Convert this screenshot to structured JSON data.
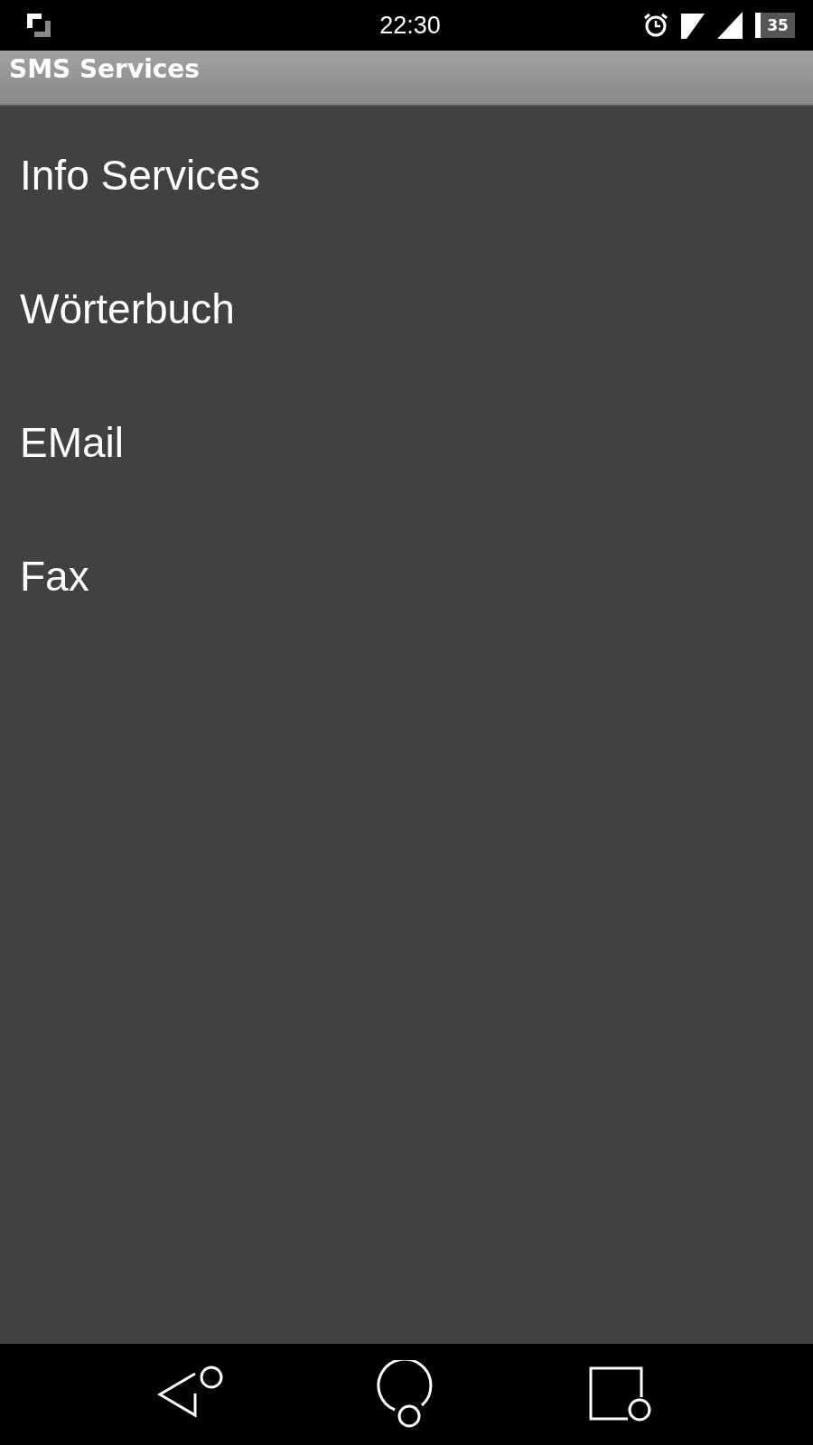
{
  "status_bar": {
    "time": "22:30",
    "battery": "35"
  },
  "app_bar": {
    "title": "SMS Services"
  },
  "items": [
    {
      "label": "Info Services"
    },
    {
      "label": "Wörterbuch"
    },
    {
      "label": "EMail"
    },
    {
      "label": "Fax"
    }
  ]
}
